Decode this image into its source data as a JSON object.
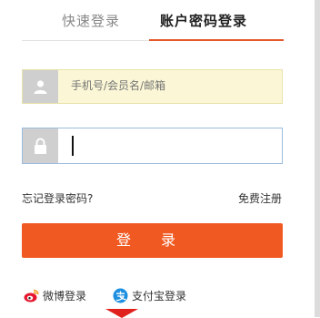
{
  "tabs": {
    "quick_login": "快速登录",
    "account_login": "账户密码登录"
  },
  "username": {
    "placeholder": "手机号/会员名/邮箱",
    "icon": "user-icon"
  },
  "password": {
    "value": "",
    "icon": "lock-icon"
  },
  "links": {
    "forgot": "忘记登录密码?",
    "register": "免费注册"
  },
  "login_button": "登 录",
  "social": {
    "weibo": "微博登录",
    "alipay": "支付宝登录"
  },
  "colors": {
    "accent": "#f05a22",
    "tab_underline": "#e4582c",
    "username_bg": "#fbf7d6",
    "password_border": "#9cbbe0"
  }
}
